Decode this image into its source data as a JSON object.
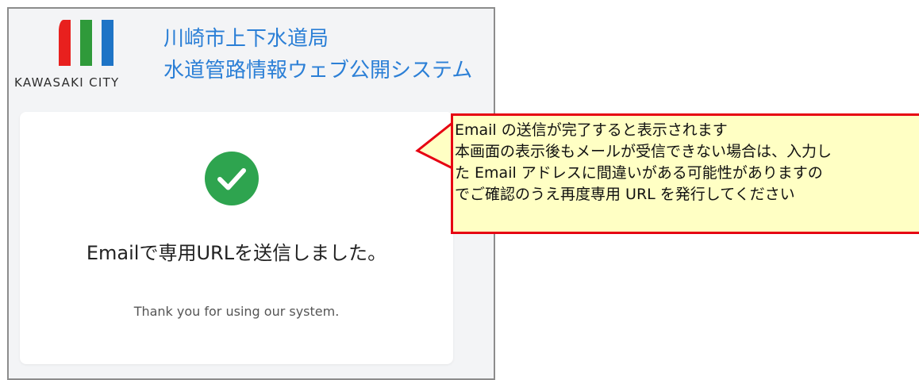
{
  "header": {
    "logo_text": "KAWASAKI CITY",
    "logo_colors": [
      "#e8201e",
      "#2f9a3a",
      "#1e74c6"
    ],
    "title_line1": "川崎市上下水道局",
    "title_line2": "水道管路情報ウェブ公開システム",
    "title_color": "#2b7fd6"
  },
  "card": {
    "icon": "check-circle-icon",
    "icon_color": "#2ea44f",
    "heading": "Emailで専用URLを送信しました。",
    "subtext": "Thank you for using our system."
  },
  "callout": {
    "border_color": "#e60012",
    "background_color": "#ffffc4",
    "lines": [
      "Email の送信が完了すると表示されます",
      "本画面の表示後もメールが受信できない場合は、入力し",
      "た Email アドレスに間違いがある可能性がありますの",
      "でご確認のうえ再度専用 URL を発行してください"
    ]
  }
}
